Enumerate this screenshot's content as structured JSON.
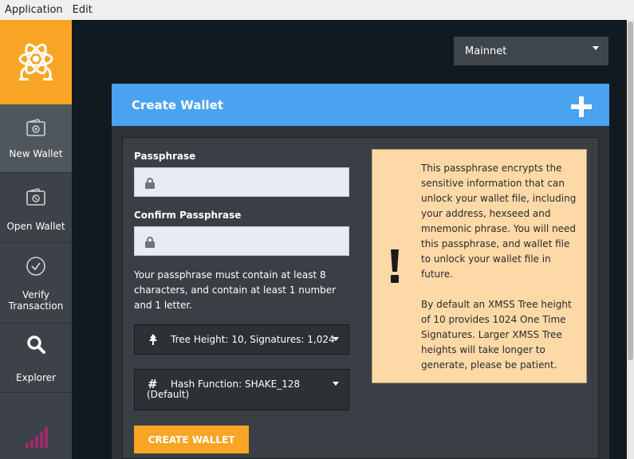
{
  "menubar": {
    "items": [
      "Application",
      "Edit"
    ]
  },
  "sidebar": {
    "items": [
      {
        "label": "New Wallet",
        "icon": "new-wallet-icon"
      },
      {
        "label": "Open Wallet",
        "icon": "open-wallet-icon"
      },
      {
        "label": "Verify Transaction",
        "icon": "check-circle-icon"
      },
      {
        "label": "Explorer",
        "icon": "search-icon"
      }
    ],
    "active": "New Wallet"
  },
  "network": {
    "selected": "Mainnet"
  },
  "panel": {
    "title": "Create Wallet",
    "passphrase_label": "Passphrase",
    "confirm_label": "Confirm Passphrase",
    "passphrase_value": "",
    "confirm_value": "",
    "hint": "Your passphrase must contain at least 8 characters, and contain at least 1 number and 1 letter.",
    "tree_height": "Tree Height: 10, Signatures: 1,024",
    "hash_function": "Hash Function: SHAKE_128 (Default)",
    "create_button": "CREATE WALLET"
  },
  "info": {
    "para1": "This passphrase encrypts the sensitive information that can unlock your wallet file, including your address, hexseed and mnemonic phrase. You will need this passphrase, and wallet file to unlock your wallet file in future.",
    "para2": "By default an XMSS Tree height of 10 provides 1024 One Time Signatures. Larger XMSS Tree heights will take longer to generate, please be patient."
  },
  "colors": {
    "accent": "#f8a526",
    "header": "#4aa3f0",
    "info_bg": "#fdd9a8"
  }
}
